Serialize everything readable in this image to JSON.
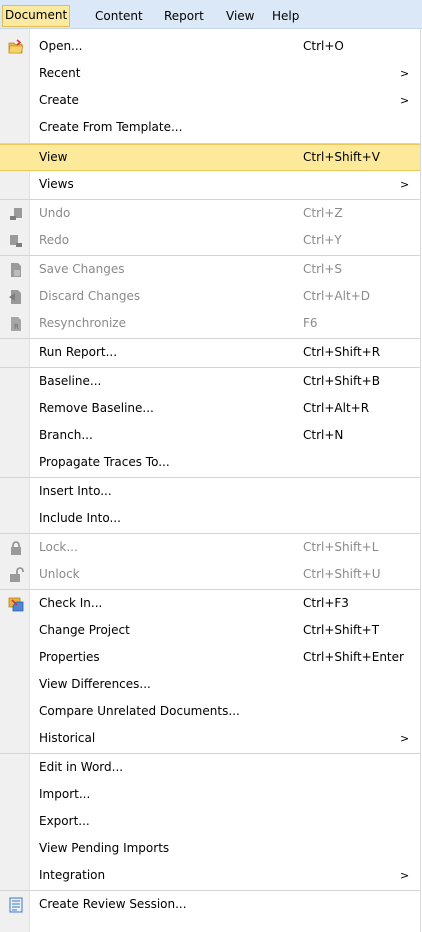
{
  "menubar": {
    "items": [
      "Document",
      "Content",
      "Report",
      "View",
      "Help"
    ]
  },
  "menu": {
    "open": "Open...",
    "open_sc": "Ctrl+O",
    "recent": "Recent",
    "create": "Create",
    "create_template": "Create From Template...",
    "view": "View",
    "view_sc": "Ctrl+Shift+V",
    "views": "Views",
    "undo": "Undo",
    "undo_sc": "Ctrl+Z",
    "redo": "Redo",
    "redo_sc": "Ctrl+Y",
    "save_changes": "Save Changes",
    "save_changes_sc": "Ctrl+S",
    "discard_changes": "Discard Changes",
    "discard_changes_sc": "Ctrl+Alt+D",
    "resynchronize": "Resynchronize",
    "resynchronize_sc": "F6",
    "run_report": "Run Report...",
    "run_report_sc": "Ctrl+Shift+R",
    "baseline": "Baseline...",
    "baseline_sc": "Ctrl+Shift+B",
    "remove_baseline": "Remove Baseline...",
    "remove_baseline_sc": "Ctrl+Alt+R",
    "branch": "Branch...",
    "branch_sc": "Ctrl+N",
    "propagate": "Propagate Traces To...",
    "insert_into": "Insert Into...",
    "include_into": "Include Into...",
    "lock": "Lock...",
    "lock_sc": "Ctrl+Shift+L",
    "unlock": "Unlock",
    "unlock_sc": "Ctrl+Shift+U",
    "check_in": "Check In...",
    "check_in_sc": "Ctrl+F3",
    "change_project": "Change Project",
    "change_project_sc": "Ctrl+Shift+T",
    "properties": "Properties",
    "properties_sc": "Ctrl+Shift+Enter",
    "view_differences": "View Differences...",
    "compare_unrelated": "Compare Unrelated Documents...",
    "historical": "Historical",
    "edit_in_word": "Edit in Word...",
    "import": "Import...",
    "export": "Export...",
    "view_pending": "View Pending Imports",
    "integration": "Integration",
    "create_review": "Create Review Session...",
    "submenu_arrow": ">"
  },
  "colors": {
    "highlight_bg": "#fde99a",
    "menubar_bg": "#dbe8f7",
    "disabled_text": "#8a8a8a"
  }
}
